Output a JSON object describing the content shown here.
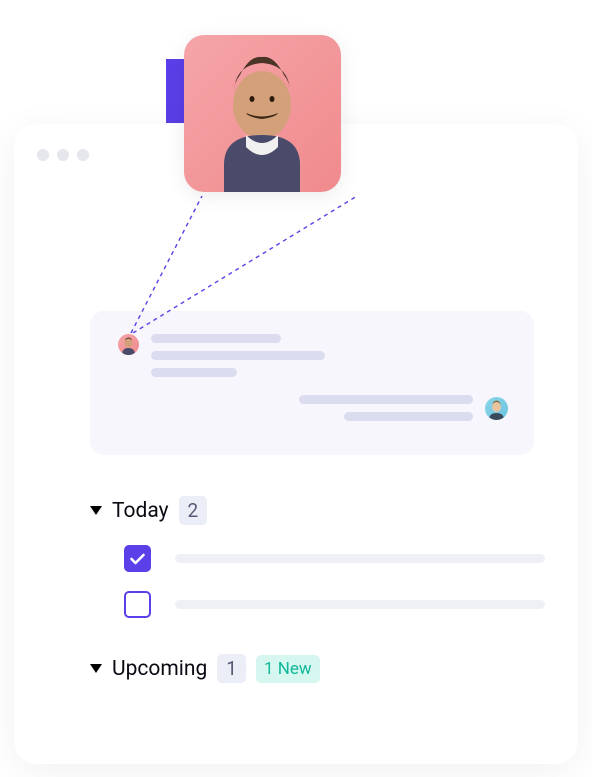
{
  "sections": {
    "today": {
      "label": "Today",
      "count": "2",
      "tasks": [
        {
          "checked": true
        },
        {
          "checked": false
        }
      ]
    },
    "upcoming": {
      "label": "Upcoming",
      "count": "1",
      "new_badge": "1 New"
    }
  },
  "colors": {
    "accent": "#5B3FE8",
    "badge_bg": "#ebedf7",
    "new_badge_bg": "#d5f7ef",
    "new_badge_fg": "#14b89a"
  }
}
